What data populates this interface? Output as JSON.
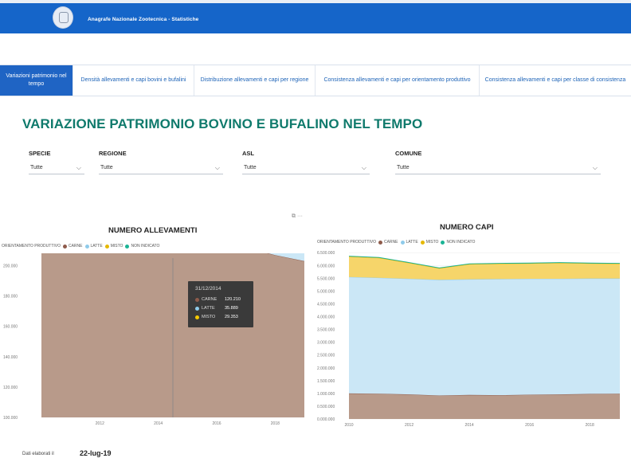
{
  "header": {
    "brand": "Anagrafe Nazionale Zootecnica - Statistiche"
  },
  "tabs": [
    {
      "label": "Variazioni patrimonio nel tempo",
      "active": true
    },
    {
      "label": "Densità allevamenti e capi bovini e bufalini",
      "active": false
    },
    {
      "label": "Distribuzione allevamenti e capi per regione",
      "active": false
    },
    {
      "label": "Consistenza allevamenti e capi per orientamento produttivo",
      "active": false
    },
    {
      "label": "Consistenza allevamenti e capi per classe di consistenza",
      "active": false
    }
  ],
  "page_title": "VARIAZIONE PATRIMONIO BOVINO E BUFALINO NEL TEMPO",
  "filters": [
    {
      "label": "SPECIE",
      "value": "Tutte"
    },
    {
      "label": "REGIONE",
      "value": "Tutte"
    },
    {
      "label": "ASL",
      "value": "Tutte"
    },
    {
      "label": "COMUNE",
      "value": "Tutte"
    }
  ],
  "toolbar": {
    "icons": "⧉ ···"
  },
  "colors": {
    "carne": "#b89a8a",
    "latte": "#cbe7f6",
    "misto": "#f6d56a",
    "non_indicato": "#1bb495",
    "carne_line": "#8e5b4b",
    "latte_line": "#8fcbea",
    "misto_line": "#e6b800"
  },
  "legend": {
    "title": "ORIENTAMENTO PRODUTTIVO",
    "items": [
      {
        "key": "carne",
        "label": "CARNE"
      },
      {
        "key": "latte",
        "label": "LATTE"
      },
      {
        "key": "misto",
        "label": "MISTO"
      },
      {
        "key": "non_indicato",
        "label": "NON INDICATO"
      }
    ]
  },
  "chart_data": [
    {
      "type": "area",
      "title": "NUMERO ALLEVAMENTI",
      "x": [
        2010,
        2011,
        2012,
        2013,
        2014,
        2015,
        2016,
        2017,
        2018,
        2019
      ],
      "xticks": [
        "2012",
        "2014",
        "2016",
        "2018"
      ],
      "yticks": [
        "100.000",
        "120.000",
        "140.000",
        "160.000",
        "180.000",
        "200.000"
      ],
      "ylim": [
        100000,
        205000
      ],
      "stacked": true,
      "series": [
        {
          "name": "CARNE",
          "values": [
            125000,
            127000,
            124000,
            122000,
            120000,
            119000,
            116000,
            112000,
            107000,
            103000
          ]
        },
        {
          "name": "LATTE",
          "values": [
            49000,
            44000,
            40000,
            36000,
            36500,
            34500,
            33000,
            32500,
            32000,
            30500
          ]
        },
        {
          "name": "MISTO",
          "values": [
            30000,
            28000,
            27000,
            26000,
            21000,
            21500,
            22000,
            23500,
            24000,
            21000
          ]
        },
        {
          "name": "NON INDICATO",
          "values": [
            400,
            300,
            200,
            200,
            150,
            150,
            150,
            150,
            150,
            150
          ]
        }
      ],
      "tooltip": {
        "date": "31/12/2014",
        "rows": [
          {
            "key": "carne",
            "label": "CARNE",
            "value": "120.210"
          },
          {
            "key": "latte",
            "label": "LATTE",
            "value": "35.889"
          },
          {
            "key": "misto",
            "label": "MISTO",
            "value": "29.353"
          }
        ]
      }
    },
    {
      "type": "area",
      "title": "NUMERO CAPI",
      "x": [
        2010,
        2011,
        2012,
        2013,
        2014,
        2015,
        2016,
        2017,
        2018,
        2019
      ],
      "xticks": [
        "2010",
        "2012",
        "2014",
        "2016",
        "2018"
      ],
      "yticks": [
        "0.000.000",
        "0.500.000",
        "1.000.000",
        "1.500.000",
        "2.000.000",
        "2.500.000",
        "3.000.000",
        "3.500.000",
        "4.000.000",
        "4.500.000",
        "5.000.000",
        "5.500.000",
        "6.000.000",
        "6.500.000"
      ],
      "ylim": [
        0,
        6600000
      ],
      "stacked": true,
      "series": [
        {
          "name": "CARNE",
          "values": [
            1000000,
            990000,
            960000,
            920000,
            940000,
            930000,
            950000,
            960000,
            980000,
            990000
          ]
        },
        {
          "name": "LATTE",
          "values": [
            4550000,
            4530000,
            4520000,
            4520000,
            4520000,
            4540000,
            4530000,
            4520000,
            4510000,
            4500000
          ]
        },
        {
          "name": "MISTO",
          "values": [
            800000,
            780000,
            620000,
            450000,
            590000,
            600000,
            600000,
            620000,
            590000,
            580000
          ]
        },
        {
          "name": "NON INDICATO",
          "values": [
            15000,
            15000,
            15000,
            15000,
            15000,
            15000,
            15000,
            15000,
            15000,
            15000
          ]
        }
      ]
    }
  ],
  "footer": {
    "label": "Dati elaborati il",
    "value": "22-lug-19"
  }
}
